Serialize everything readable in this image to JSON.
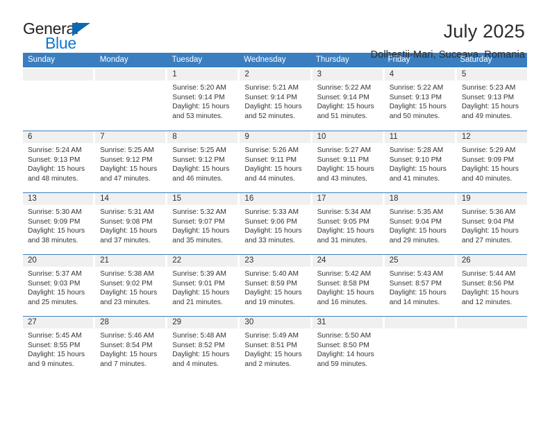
{
  "brand": {
    "name_part1": "General",
    "name_part2": "Blue",
    "triangle_color": "#0b69b4",
    "blue_color": "#0b78d0"
  },
  "header": {
    "title": "July 2025",
    "subtitle": "Dolhestii-Mari, Suceava, Romania"
  },
  "theme": {
    "header_band_color": "#3a7ebf",
    "day_band_color": "#f0f0f0",
    "text_color": "#333333"
  },
  "calendar": {
    "weekday_headers": [
      "Sunday",
      "Monday",
      "Tuesday",
      "Wednesday",
      "Thursday",
      "Friday",
      "Saturday"
    ],
    "weeks": [
      [
        {
          "day": "",
          "sunrise": "",
          "sunset": "",
          "daylight_1": "",
          "daylight_2": ""
        },
        {
          "day": "",
          "sunrise": "",
          "sunset": "",
          "daylight_1": "",
          "daylight_2": ""
        },
        {
          "day": "1",
          "sunrise": "Sunrise: 5:20 AM",
          "sunset": "Sunset: 9:14 PM",
          "daylight_1": "Daylight: 15 hours",
          "daylight_2": "and 53 minutes."
        },
        {
          "day": "2",
          "sunrise": "Sunrise: 5:21 AM",
          "sunset": "Sunset: 9:14 PM",
          "daylight_1": "Daylight: 15 hours",
          "daylight_2": "and 52 minutes."
        },
        {
          "day": "3",
          "sunrise": "Sunrise: 5:22 AM",
          "sunset": "Sunset: 9:14 PM",
          "daylight_1": "Daylight: 15 hours",
          "daylight_2": "and 51 minutes."
        },
        {
          "day": "4",
          "sunrise": "Sunrise: 5:22 AM",
          "sunset": "Sunset: 9:13 PM",
          "daylight_1": "Daylight: 15 hours",
          "daylight_2": "and 50 minutes."
        },
        {
          "day": "5",
          "sunrise": "Sunrise: 5:23 AM",
          "sunset": "Sunset: 9:13 PM",
          "daylight_1": "Daylight: 15 hours",
          "daylight_2": "and 49 minutes."
        }
      ],
      [
        {
          "day": "6",
          "sunrise": "Sunrise: 5:24 AM",
          "sunset": "Sunset: 9:13 PM",
          "daylight_1": "Daylight: 15 hours",
          "daylight_2": "and 48 minutes."
        },
        {
          "day": "7",
          "sunrise": "Sunrise: 5:25 AM",
          "sunset": "Sunset: 9:12 PM",
          "daylight_1": "Daylight: 15 hours",
          "daylight_2": "and 47 minutes."
        },
        {
          "day": "8",
          "sunrise": "Sunrise: 5:25 AM",
          "sunset": "Sunset: 9:12 PM",
          "daylight_1": "Daylight: 15 hours",
          "daylight_2": "and 46 minutes."
        },
        {
          "day": "9",
          "sunrise": "Sunrise: 5:26 AM",
          "sunset": "Sunset: 9:11 PM",
          "daylight_1": "Daylight: 15 hours",
          "daylight_2": "and 44 minutes."
        },
        {
          "day": "10",
          "sunrise": "Sunrise: 5:27 AM",
          "sunset": "Sunset: 9:11 PM",
          "daylight_1": "Daylight: 15 hours",
          "daylight_2": "and 43 minutes."
        },
        {
          "day": "11",
          "sunrise": "Sunrise: 5:28 AM",
          "sunset": "Sunset: 9:10 PM",
          "daylight_1": "Daylight: 15 hours",
          "daylight_2": "and 41 minutes."
        },
        {
          "day": "12",
          "sunrise": "Sunrise: 5:29 AM",
          "sunset": "Sunset: 9:09 PM",
          "daylight_1": "Daylight: 15 hours",
          "daylight_2": "and 40 minutes."
        }
      ],
      [
        {
          "day": "13",
          "sunrise": "Sunrise: 5:30 AM",
          "sunset": "Sunset: 9:09 PM",
          "daylight_1": "Daylight: 15 hours",
          "daylight_2": "and 38 minutes."
        },
        {
          "day": "14",
          "sunrise": "Sunrise: 5:31 AM",
          "sunset": "Sunset: 9:08 PM",
          "daylight_1": "Daylight: 15 hours",
          "daylight_2": "and 37 minutes."
        },
        {
          "day": "15",
          "sunrise": "Sunrise: 5:32 AM",
          "sunset": "Sunset: 9:07 PM",
          "daylight_1": "Daylight: 15 hours",
          "daylight_2": "and 35 minutes."
        },
        {
          "day": "16",
          "sunrise": "Sunrise: 5:33 AM",
          "sunset": "Sunset: 9:06 PM",
          "daylight_1": "Daylight: 15 hours",
          "daylight_2": "and 33 minutes."
        },
        {
          "day": "17",
          "sunrise": "Sunrise: 5:34 AM",
          "sunset": "Sunset: 9:05 PM",
          "daylight_1": "Daylight: 15 hours",
          "daylight_2": "and 31 minutes."
        },
        {
          "day": "18",
          "sunrise": "Sunrise: 5:35 AM",
          "sunset": "Sunset: 9:04 PM",
          "daylight_1": "Daylight: 15 hours",
          "daylight_2": "and 29 minutes."
        },
        {
          "day": "19",
          "sunrise": "Sunrise: 5:36 AM",
          "sunset": "Sunset: 9:04 PM",
          "daylight_1": "Daylight: 15 hours",
          "daylight_2": "and 27 minutes."
        }
      ],
      [
        {
          "day": "20",
          "sunrise": "Sunrise: 5:37 AM",
          "sunset": "Sunset: 9:03 PM",
          "daylight_1": "Daylight: 15 hours",
          "daylight_2": "and 25 minutes."
        },
        {
          "day": "21",
          "sunrise": "Sunrise: 5:38 AM",
          "sunset": "Sunset: 9:02 PM",
          "daylight_1": "Daylight: 15 hours",
          "daylight_2": "and 23 minutes."
        },
        {
          "day": "22",
          "sunrise": "Sunrise: 5:39 AM",
          "sunset": "Sunset: 9:01 PM",
          "daylight_1": "Daylight: 15 hours",
          "daylight_2": "and 21 minutes."
        },
        {
          "day": "23",
          "sunrise": "Sunrise: 5:40 AM",
          "sunset": "Sunset: 8:59 PM",
          "daylight_1": "Daylight: 15 hours",
          "daylight_2": "and 19 minutes."
        },
        {
          "day": "24",
          "sunrise": "Sunrise: 5:42 AM",
          "sunset": "Sunset: 8:58 PM",
          "daylight_1": "Daylight: 15 hours",
          "daylight_2": "and 16 minutes."
        },
        {
          "day": "25",
          "sunrise": "Sunrise: 5:43 AM",
          "sunset": "Sunset: 8:57 PM",
          "daylight_1": "Daylight: 15 hours",
          "daylight_2": "and 14 minutes."
        },
        {
          "day": "26",
          "sunrise": "Sunrise: 5:44 AM",
          "sunset": "Sunset: 8:56 PM",
          "daylight_1": "Daylight: 15 hours",
          "daylight_2": "and 12 minutes."
        }
      ],
      [
        {
          "day": "27",
          "sunrise": "Sunrise: 5:45 AM",
          "sunset": "Sunset: 8:55 PM",
          "daylight_1": "Daylight: 15 hours",
          "daylight_2": "and 9 minutes."
        },
        {
          "day": "28",
          "sunrise": "Sunrise: 5:46 AM",
          "sunset": "Sunset: 8:54 PM",
          "daylight_1": "Daylight: 15 hours",
          "daylight_2": "and 7 minutes."
        },
        {
          "day": "29",
          "sunrise": "Sunrise: 5:48 AM",
          "sunset": "Sunset: 8:52 PM",
          "daylight_1": "Daylight: 15 hours",
          "daylight_2": "and 4 minutes."
        },
        {
          "day": "30",
          "sunrise": "Sunrise: 5:49 AM",
          "sunset": "Sunset: 8:51 PM",
          "daylight_1": "Daylight: 15 hours",
          "daylight_2": "and 2 minutes."
        },
        {
          "day": "31",
          "sunrise": "Sunrise: 5:50 AM",
          "sunset": "Sunset: 8:50 PM",
          "daylight_1": "Daylight: 14 hours",
          "daylight_2": "and 59 minutes."
        },
        {
          "day": "",
          "sunrise": "",
          "sunset": "",
          "daylight_1": "",
          "daylight_2": ""
        },
        {
          "day": "",
          "sunrise": "",
          "sunset": "",
          "daylight_1": "",
          "daylight_2": ""
        }
      ]
    ]
  }
}
